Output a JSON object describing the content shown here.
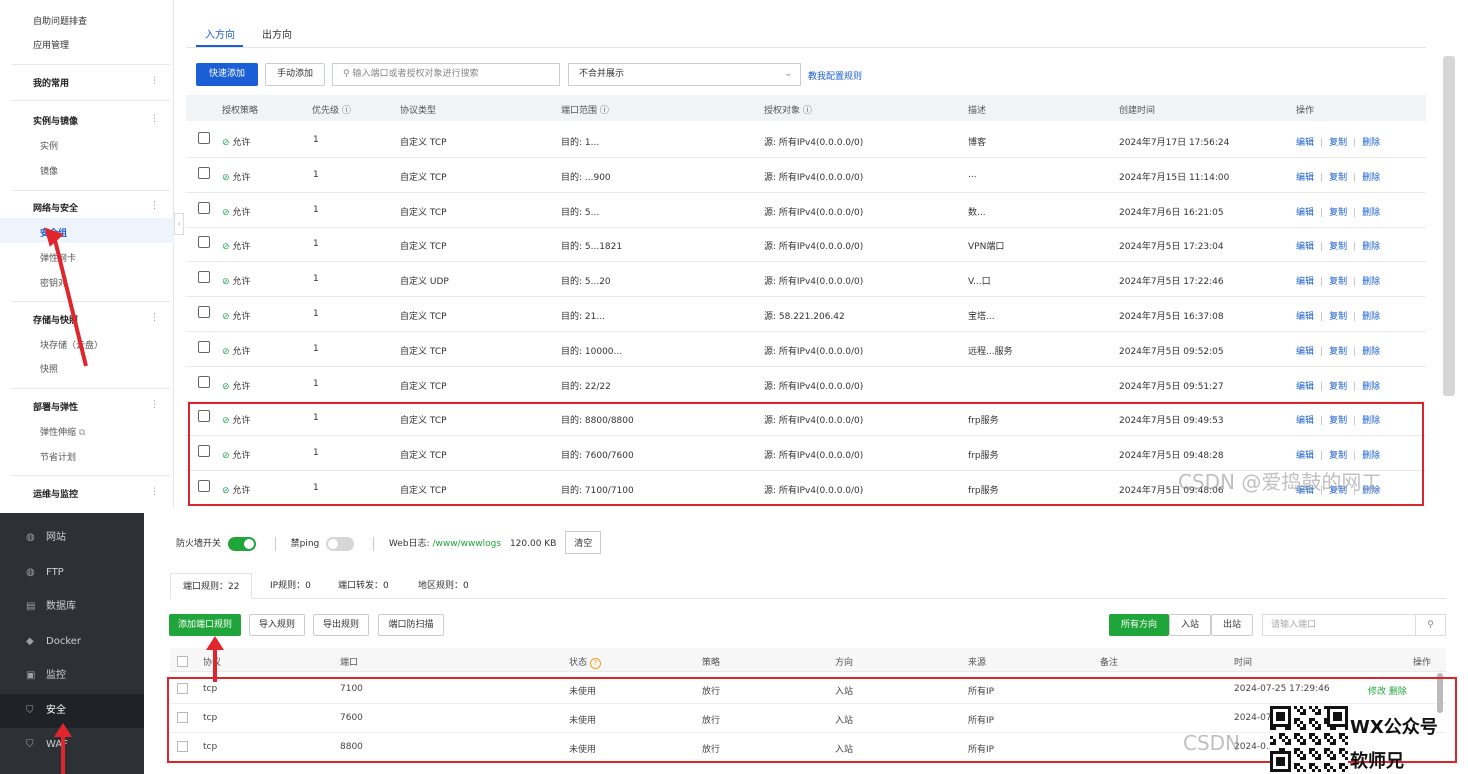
{
  "top": {
    "sidebar": {
      "items": [
        {
          "label": "自助问题排查"
        },
        {
          "label": "应用管理"
        }
      ],
      "sections": [
        {
          "label": "我的常用"
        },
        {
          "label": "实例与镜像",
          "children": [
            "实例",
            "镜像"
          ]
        },
        {
          "label": "网络与安全",
          "children": [
            "安全组",
            "弹性网卡",
            "密钥对"
          ]
        },
        {
          "label": "存储与快照",
          "children": [
            "块存储（云盘）",
            "快照"
          ]
        },
        {
          "label": "部署与弹性",
          "children": [
            "弹性伸缩",
            "节省计划"
          ]
        },
        {
          "label": "运维与监控"
        }
      ],
      "dots": "⋮",
      "active": "安全组"
    },
    "tabs": [
      "入方向",
      "出方向"
    ],
    "toolbar": {
      "quick_add": "快速添加",
      "manual_add": "手动添加",
      "search_placeholder": "输入端口或者授权对象进行搜索",
      "merge_select": "不合并展示",
      "teach_link": "教我配置规则"
    },
    "columns": [
      "授权策略",
      "优先级 ⓘ",
      "协议类型",
      "端口范围 ⓘ",
      "授权对象 ⓘ",
      "描述",
      "创建时间",
      "操作"
    ],
    "rows": [
      {
        "policy": "允许",
        "priority": "1",
        "protocol": "自定义 TCP",
        "port": "目的: 1...",
        "object": "源: 所有IPv4(0.0.0.0/0)",
        "desc": "博客",
        "time": "2024年7月17日 17:56:24"
      },
      {
        "policy": "允许",
        "priority": "1",
        "protocol": "自定义 TCP",
        "port": "目的: ...900",
        "object": "源: 所有IPv4(0.0.0.0/0)",
        "desc": "...",
        "time": "2024年7月15日 11:14:00"
      },
      {
        "policy": "允许",
        "priority": "1",
        "protocol": "自定义 TCP",
        "port": "目的: 5...",
        "object": "源: 所有IPv4(0.0.0.0/0)",
        "desc": "数...",
        "time": "2024年7月6日 16:21:05"
      },
      {
        "policy": "允许",
        "priority": "1",
        "protocol": "自定义 TCP",
        "port": "目的: 5...1821",
        "object": "源: 所有IPv4(0.0.0.0/0)",
        "desc": "VPN端口",
        "time": "2024年7月5日 17:23:04"
      },
      {
        "policy": "允许",
        "priority": "1",
        "protocol": "自定义 UDP",
        "port": "目的: 5...20",
        "object": "源: 所有IPv4(0.0.0.0/0)",
        "desc": "V...口",
        "time": "2024年7月5日 17:22:46"
      },
      {
        "policy": "允许",
        "priority": "1",
        "protocol": "自定义 TCP",
        "port": "目的: 21...",
        "object": "源: 58.221.206.42",
        "desc": "宝塔...",
        "time": "2024年7月5日 16:37:08"
      },
      {
        "policy": "允许",
        "priority": "1",
        "protocol": "自定义 TCP",
        "port": "目的: 10000...",
        "object": "源: 所有IPv4(0.0.0.0/0)",
        "desc": "远程...服务",
        "time": "2024年7月5日 09:52:05"
      },
      {
        "policy": "允许",
        "priority": "1",
        "protocol": "自定义 TCP",
        "port": "目的: 22/22",
        "object": "源: 所有IPv4(0.0.0.0/0)",
        "desc": "",
        "time": "2024年7月5日 09:51:27"
      },
      {
        "policy": "允许",
        "priority": "1",
        "protocol": "自定义 TCP",
        "port": "目的: 8800/8800",
        "object": "源: 所有IPv4(0.0.0.0/0)",
        "desc": "frp服务",
        "time": "2024年7月5日 09:49:53"
      },
      {
        "policy": "允许",
        "priority": "1",
        "protocol": "自定义 TCP",
        "port": "目的: 7600/7600",
        "object": "源: 所有IPv4(0.0.0.0/0)",
        "desc": "frp服务",
        "time": "2024年7月5日 09:48:28"
      },
      {
        "policy": "允许",
        "priority": "1",
        "protocol": "自定义 TCP",
        "port": "目的: 7100/7100",
        "object": "源: 所有IPv4(0.0.0.0/0)",
        "desc": "frp服务",
        "time": "2024年7月5日 09:48:06"
      }
    ],
    "ops": {
      "edit": "编辑",
      "copy": "复制",
      "del": "删除",
      "sep": "|"
    },
    "watermark": "CSDN @爱捣鼓的网工"
  },
  "bottom": {
    "sidebar": [
      {
        "label": "网站",
        "icon": "globe-icon",
        "glyph": "◍"
      },
      {
        "label": "FTP",
        "icon": "ftp-icon",
        "glyph": "◍"
      },
      {
        "label": "数据库",
        "icon": "database-icon",
        "glyph": "▤"
      },
      {
        "label": "Docker",
        "icon": "docker-icon",
        "glyph": "◆"
      },
      {
        "label": "监控",
        "icon": "monitor-icon",
        "glyph": "▣"
      },
      {
        "label": "安全",
        "icon": "shield-icon",
        "glyph": "⛉"
      },
      {
        "label": "WAF",
        "icon": "waf-icon",
        "glyph": "⛉"
      }
    ],
    "firewall": {
      "switch_label": "防火墙开关",
      "ping_label": "禁ping",
      "weblog_label": "Web日志:",
      "weblog_path": "/www/wwwlogs",
      "weblog_size": "120.00 KB",
      "clear": "清空"
    },
    "tabs": [
      "端口规则：22",
      "IP规则：0",
      "端口转发：0",
      "地区规则：0"
    ],
    "toolbar": {
      "add": "添加端口规则",
      "import": "导入规则",
      "export": "导出规则",
      "scan": "端口防扫描",
      "dir_all": "所有方向",
      "dir_in": "入站",
      "dir_out": "出站",
      "search_placeholder": "请输入端口"
    },
    "columns": [
      "协议",
      "端口",
      "状态",
      "策略",
      "方向",
      "来源",
      "备注",
      "时间",
      "操作"
    ],
    "rows": [
      {
        "proto": "tcp",
        "port": "7100",
        "status": "未使用",
        "policy": "放行",
        "dir": "入站",
        "src": "所有IP",
        "time": "2024-07-25 17:29:46",
        "op1": "修改",
        "op2": "删除"
      },
      {
        "proto": "tcp",
        "port": "7600",
        "status": "未使用",
        "policy": "放行",
        "dir": "入站",
        "src": "所有IP",
        "time": "2024-07-...",
        "op1": "",
        "op2": ""
      },
      {
        "proto": "tcp",
        "port": "8800",
        "status": "未使用",
        "policy": "放行",
        "dir": "入站",
        "src": "所有IP",
        "time": "2024-0...",
        "op1": "",
        "op2": ""
      }
    ],
    "watermark": "CSDN",
    "wx_title": "WX公众号",
    "wx_name": "软师兄"
  }
}
